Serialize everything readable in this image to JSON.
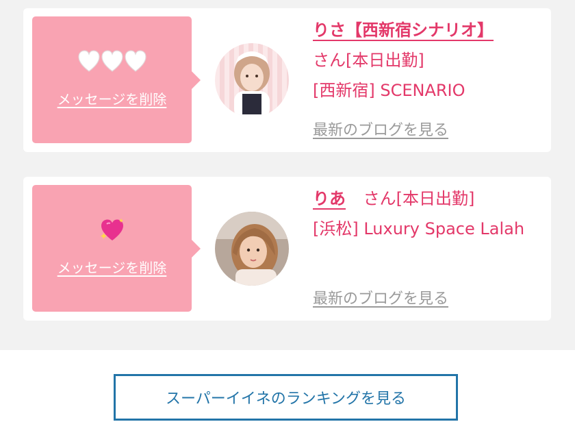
{
  "messages": [
    {
      "reaction": {
        "icon": "three-white-hearts-icon",
        "glyphs": "🤍🤍🤍"
      },
      "delete_label": "メッセージを削除",
      "name": "りさ【西新宿シナリオ】",
      "name_suffix": "さん[本日出勤]",
      "shop": "[西新宿] SCENARIO",
      "blog_link": "最新のブログを見る",
      "avatar": "avatar-photo"
    },
    {
      "reaction": {
        "icon": "sparkling-heart-icon",
        "glyphs": "💖"
      },
      "delete_label": "メッセージを削除",
      "name": "りあ",
      "name_suffix": "さん[本日出勤]",
      "shop": "[浜松] Luxury Space Lalah",
      "blog_link": "最新のブログを見る",
      "avatar": "avatar-photo"
    }
  ],
  "ranking_button": "スーパーイイネのランキングを見る",
  "colors": {
    "accent_pink": "#e33869",
    "bubble_pink": "#f9a3b2",
    "link_gray": "#9a9a9a",
    "button_blue": "#2274a8",
    "list_background": "#f2f2f2"
  }
}
